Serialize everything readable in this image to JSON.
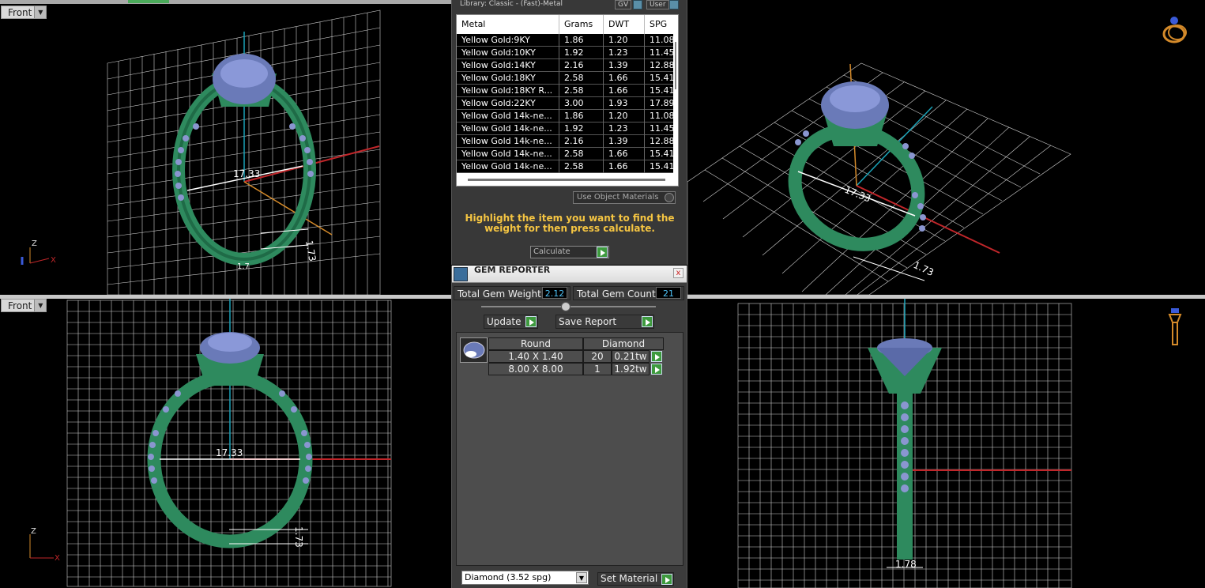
{
  "viewports": {
    "top_left": {
      "label": "Front",
      "dimension_a": "17.33",
      "dimension_b": "1.73",
      "dimension_c": "1.7",
      "axis_z": "Z",
      "axis_x": "X"
    },
    "top_right": {
      "dimension_a": "17.33",
      "dimension_b": "1.73"
    },
    "bottom_left": {
      "label": "Front",
      "dimension_a": "17.33",
      "dimension_b": "1.73",
      "axis_z": "Z",
      "axis_x": "X"
    },
    "bottom_right": {
      "dimension_a": "1.78"
    }
  },
  "metal_panel": {
    "library_title": "Library: Classic - (Fast)-Metal",
    "gv_label": "GV",
    "user_label": "User",
    "columns": [
      "Metal",
      "Grams",
      "DWT",
      "SPG"
    ],
    "rows": [
      [
        "Yellow Gold:9KY",
        "1.86",
        "1.20",
        "11.08"
      ],
      [
        "Yellow Gold:10KY",
        "1.92",
        "1.23",
        "11.45"
      ],
      [
        "Yellow Gold:14KY",
        "2.16",
        "1.39",
        "12.88"
      ],
      [
        "Yellow Gold:18KY",
        "2.58",
        "1.66",
        "15.41"
      ],
      [
        "Yellow Gold:18KY R...",
        "2.58",
        "1.66",
        "15.41"
      ],
      [
        "Yellow Gold:22KY",
        "3.00",
        "1.93",
        "17.89"
      ],
      [
        "Yellow Gold 14k-ne...",
        "1.86",
        "1.20",
        "11.08"
      ],
      [
        "Yellow Gold 14k-ne...",
        "1.92",
        "1.23",
        "11.45"
      ],
      [
        "Yellow Gold 14k-ne...",
        "2.16",
        "1.39",
        "12.88"
      ],
      [
        "Yellow Gold 14k-ne...",
        "2.58",
        "1.66",
        "15.41"
      ],
      [
        "Yellow Gold 14k-ne...",
        "2.58",
        "1.66",
        "15.41"
      ]
    ],
    "use_object_materials": "Use Object Materials",
    "hint": "Highlight the item you want to find the weight for then press calculate.",
    "calculate": "Calculate"
  },
  "gem_reporter": {
    "title": "GEM REPORTER",
    "close": "x",
    "total_gem_weight_label": "Total Gem Weight",
    "total_gem_weight_value": "2.12",
    "total_gem_count_label": "Total Gem Count",
    "total_gem_count_value": "21",
    "update": "Update",
    "save_report": "Save Report",
    "table": {
      "shape": "Round",
      "material": "Diamond",
      "rows": [
        {
          "size": "1.40 X 1.40",
          "count": "20",
          "weight": "0.21tw"
        },
        {
          "size": "8.00 X 8.00",
          "count": "1",
          "weight": "1.92tw"
        }
      ]
    },
    "material_select": "Diamond    (3.52 spg)",
    "set_material": "Set Material"
  },
  "colors": {
    "ring_green": "#2e8a5e",
    "gem_blue": "#6a7ab8",
    "hint_yellow": "#f5c542",
    "value_cyan": "#4fc3f7",
    "axis_red": "#c0262a",
    "axis_cyan": "#1aa3b8",
    "axis_orange": "#d48a2a"
  }
}
